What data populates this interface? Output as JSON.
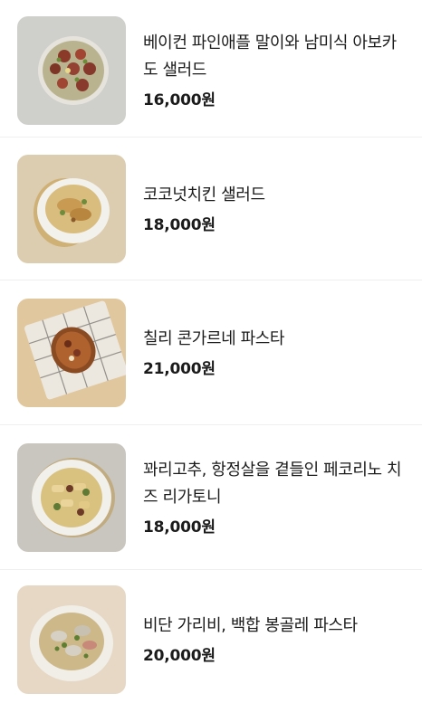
{
  "menu": {
    "items": [
      {
        "name": "베이컨 파인애플 말이와 남미식 아보카도 샐러드",
        "price": "16,000원",
        "image": "salad-bacon-pineapple-photo"
      },
      {
        "name": "코코넛치킨 샐러드",
        "price": "18,000원",
        "image": "coconut-chicken-salad-photo"
      },
      {
        "name": "칠리 콘가르네 파스타",
        "price": "21,000원",
        "image": "chili-con-carne-pasta-photo"
      },
      {
        "name": "꽈리고추, 항정살을 곁들인 페코리노 치즈 리가토니",
        "price": "18,000원",
        "image": "rigatoni-photo"
      },
      {
        "name": "비단 가리비, 백합 봉골레 파스타",
        "price": "20,000원",
        "image": "vongole-pasta-photo"
      }
    ]
  }
}
